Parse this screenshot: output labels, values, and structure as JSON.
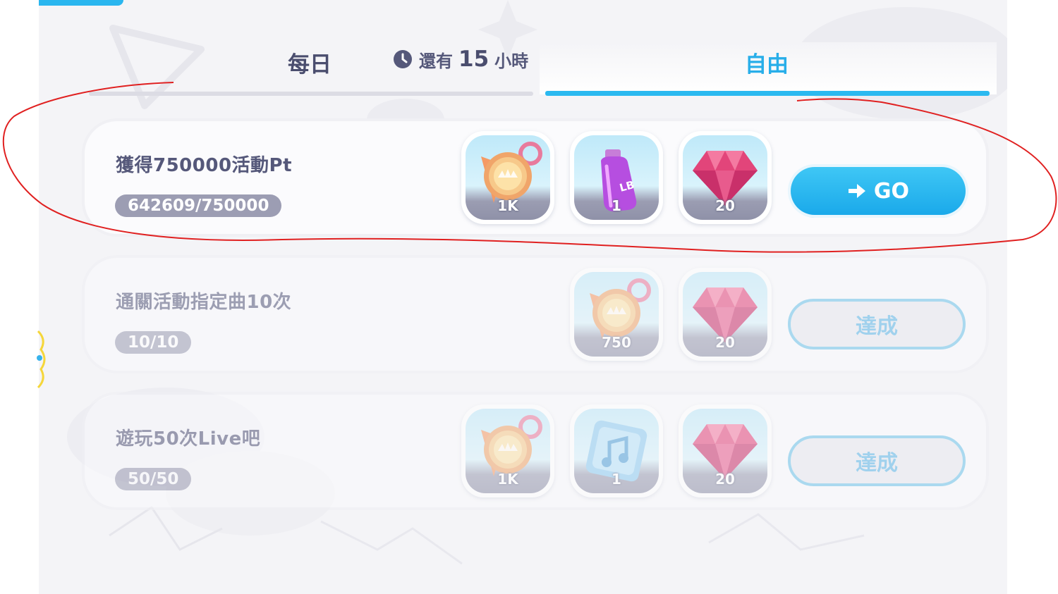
{
  "tabs": {
    "daily_label": "每日",
    "timer_prefix": "還有",
    "timer_value": "15",
    "timer_suffix": "小時",
    "free_label": "自由",
    "active": "自由"
  },
  "missions": [
    {
      "title": "獲得750000活動Pt",
      "progress": "642609/750000",
      "rewards": [
        {
          "icon": "medal-icon",
          "qty": "1K"
        },
        {
          "icon": "lb-bottle-icon",
          "qty": "1"
        },
        {
          "icon": "gem-icon",
          "qty": "20"
        }
      ],
      "action": "GO",
      "state": "in-progress"
    },
    {
      "title": "通關活動指定曲10次",
      "progress": "10/10",
      "rewards": [
        {
          "icon": "medal-icon",
          "qty": "750"
        },
        {
          "icon": "gem-icon",
          "qty": "20"
        }
      ],
      "action": "達成",
      "state": "completed"
    },
    {
      "title": "遊玩50次Live吧",
      "progress": "50/50",
      "rewards": [
        {
          "icon": "medal-icon",
          "qty": "1K"
        },
        {
          "icon": "music-ticket-icon",
          "qty": "1"
        },
        {
          "icon": "gem-icon",
          "qty": "20"
        }
      ],
      "action": "達成",
      "state": "completed"
    }
  ],
  "colors": {
    "accent": "#2bb9f0",
    "text": "#55587a",
    "badge": "#9c9db3",
    "annotation": "#e02020"
  }
}
